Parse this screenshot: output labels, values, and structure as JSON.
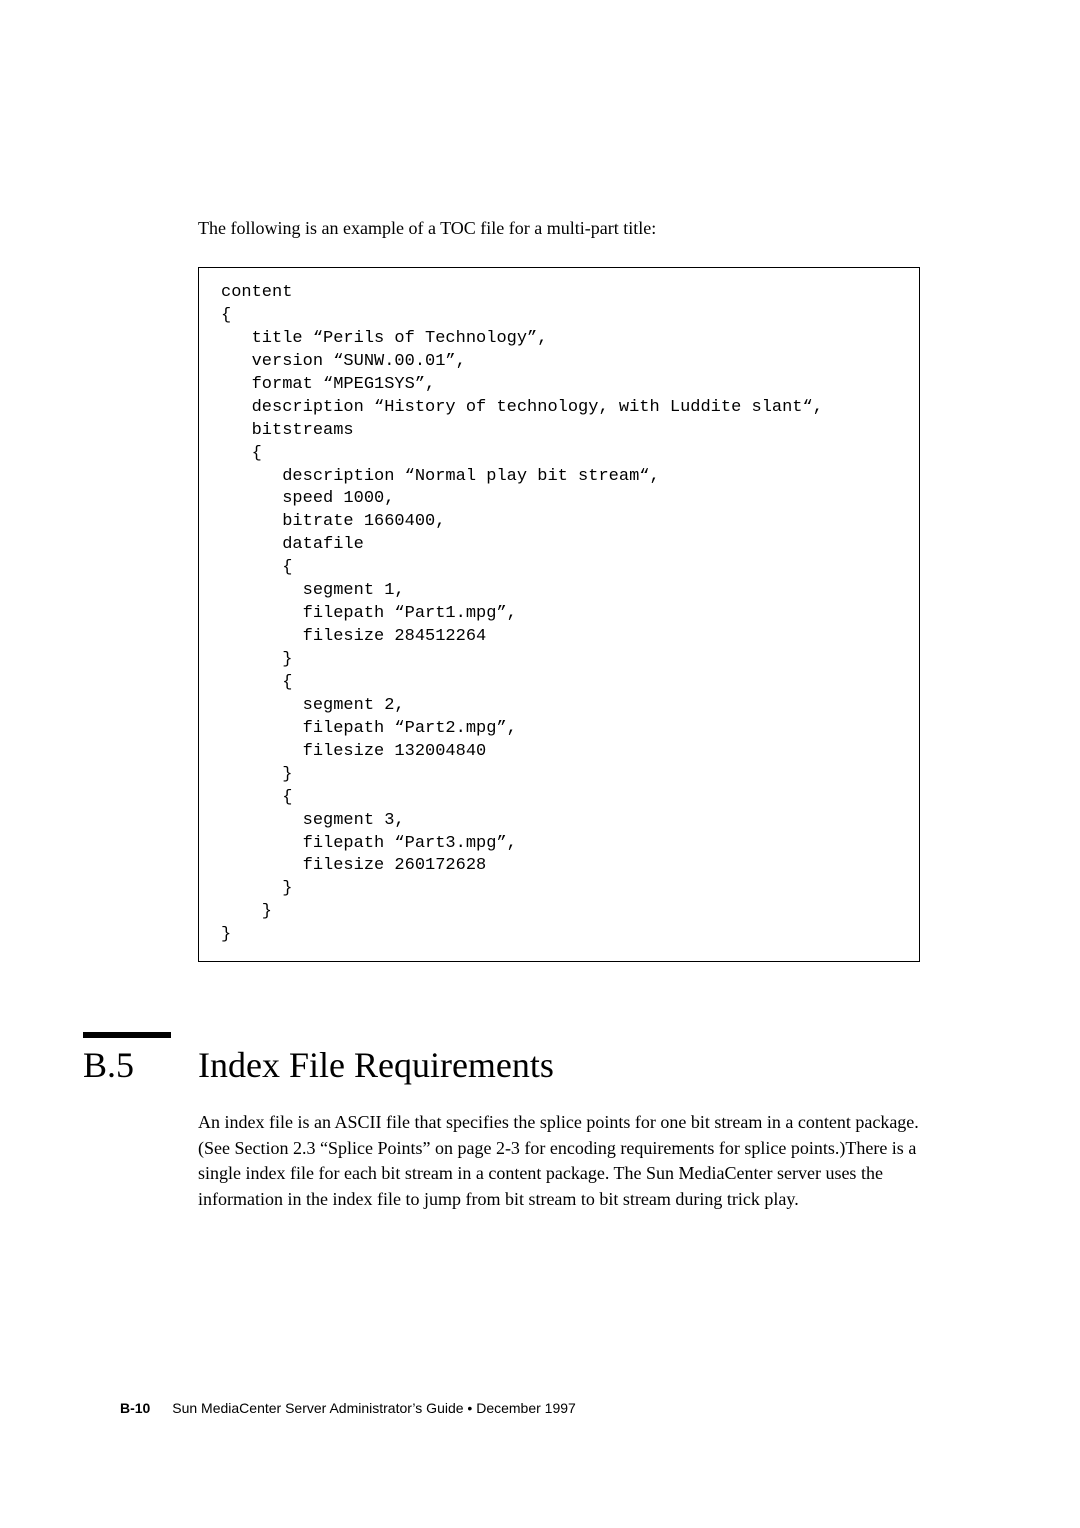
{
  "intro": "The following is an example of a TOC file for a multi-part title:",
  "code": "content\n{\n   title “Perils of Technology”,\n   version “SUNW.00.01”,\n   format “MPEG1SYS”,\n   description “History of technology, with Luddite slant“,\n   bitstreams\n   {\n      description “Normal play bit stream“,\n      speed 1000,\n      bitrate 1660400,\n      datafile\n      {\n        segment 1,\n        filepath “Part1.mpg”,\n        filesize 284512264\n      }\n      {\n        segment 2,\n        filepath “Part2.mpg”,\n        filesize 132004840\n      }\n      {\n        segment 3,\n        filepath “Part3.mpg”,\n        filesize 260172628\n      }\n    }\n}",
  "section": {
    "number": "B.5",
    "title": "Index File Requirements",
    "body": "An index file is an ASCII file that specifies the splice points for one bit stream in a content package. (See Section 2.3 “Splice Points” on page 2-3 for encoding requirements for splice points.)There is a single index file for each bit stream in a content package. The Sun MediaCenter server uses the information in the index file to jump from bit stream to bit stream during trick play."
  },
  "footer": {
    "pagenum": "B-10",
    "text": "Sun MediaCenter Server Administrator’s Guide • December 1997"
  }
}
